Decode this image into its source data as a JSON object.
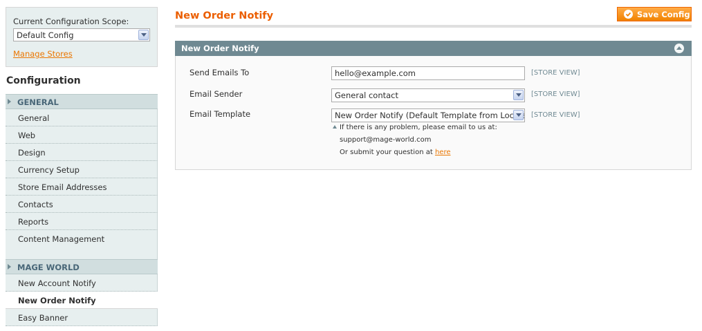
{
  "sidebar": {
    "scope_label": "Current Configuration Scope:",
    "scope_value": "Default Config",
    "manage_stores": "Manage Stores",
    "config_title": "Configuration",
    "sections": [
      {
        "title": "GENERAL",
        "items": [
          "General",
          "Web",
          "Design",
          "Currency Setup",
          "Store Email Addresses",
          "Contacts",
          "Reports",
          "Content Management"
        ]
      },
      {
        "title": "MAGE WORLD",
        "items": [
          "New Account Notify",
          "New Order Notify",
          "Easy Banner"
        ]
      }
    ],
    "active_item": "New Order Notify"
  },
  "main": {
    "title": "New Order Notify",
    "save_label": "Save Config",
    "fieldset_title": "New Order Notify",
    "rows": [
      {
        "label": "Send Emails To",
        "value": "hello@example.com",
        "scope": "[STORE VIEW]"
      },
      {
        "label": "Email Sender",
        "value": "General contact",
        "scope": "[STORE VIEW]"
      },
      {
        "label": "Email Template",
        "value": "New Order Notify (Default Template from Locale)",
        "scope": "[STORE VIEW]"
      }
    ],
    "note": {
      "line1": "If there is any problem, please email to us at:",
      "line2": "support@mage-world.com",
      "line3_prefix": "Or submit your question at ",
      "line3_link": "here"
    }
  },
  "colors": {
    "accent": "#eb5e00",
    "button": "#f18200",
    "fieldset_header": "#6f8992",
    "sidebar_bg": "#e7efef"
  }
}
